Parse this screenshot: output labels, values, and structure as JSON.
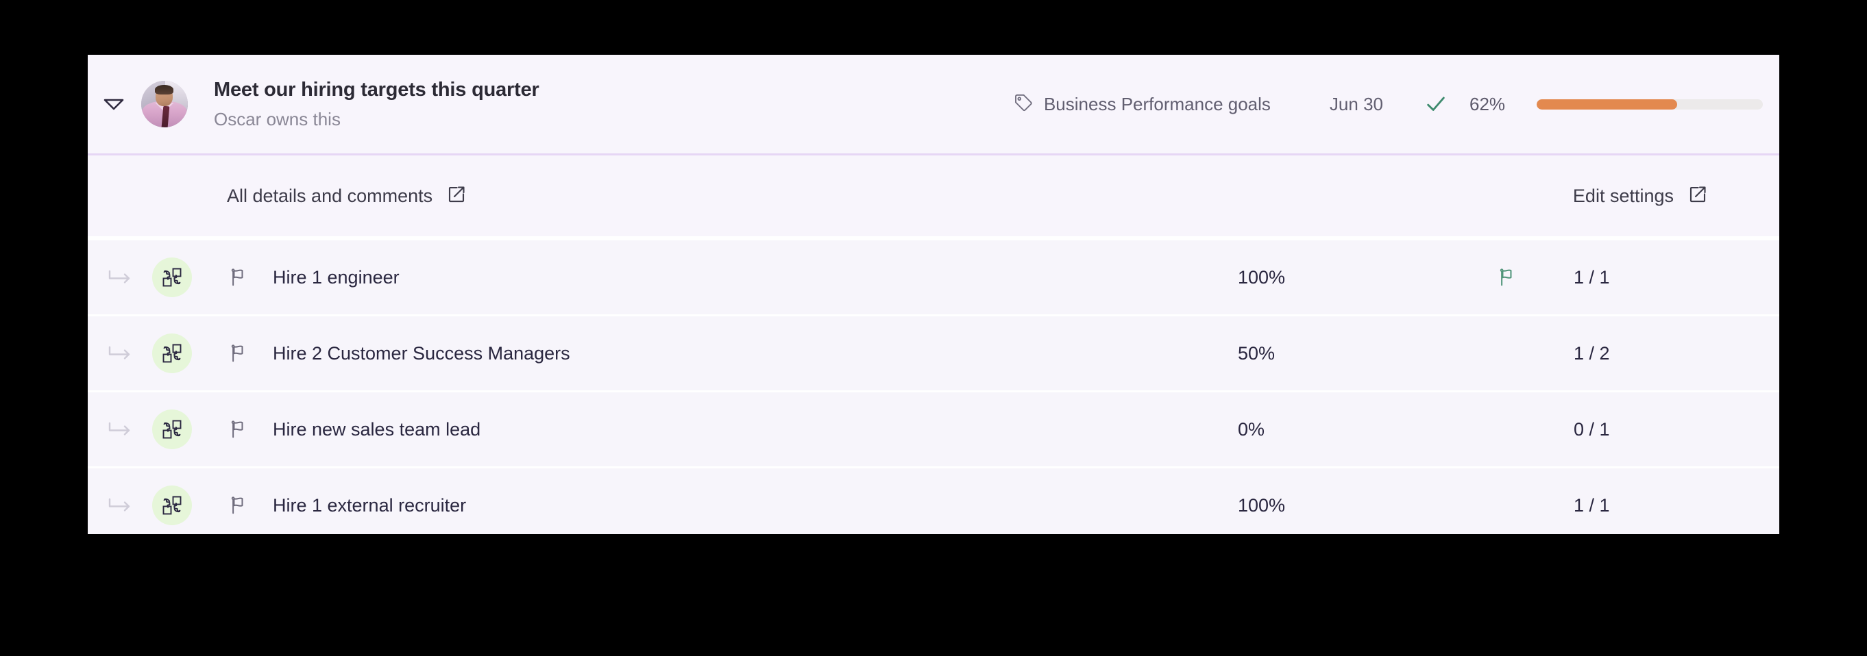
{
  "goal": {
    "collapse_icon": "chevron-down-icon",
    "avatar_icon": "owner-avatar",
    "title": "Meet our hiring targets this quarter",
    "owner": "Oscar owns this",
    "tag_icon": "tag-icon",
    "tag": "Business Performance goals",
    "due_date": "Jun 30",
    "status_icon": "check-icon",
    "progress_percent": "62%",
    "progress_value": 62,
    "colors": {
      "progress_fill": "#e3894f",
      "progress_track": "#eceaea",
      "check": "#3d8a6d",
      "card_bg": "#f8f5fc",
      "header_border": "#e6d6f5",
      "badge_bg": "#e6f6d9"
    }
  },
  "toolbar": {
    "details_label": "All details and comments",
    "details_icon": "external-link-icon",
    "settings_label": "Edit settings",
    "settings_icon": "external-link-icon"
  },
  "tasks": [
    {
      "subtask_icon": "subtask-arrow-icon",
      "badge_icon": "puzzle-pieces-icon",
      "flag_icon": "flag-outline-icon",
      "name": "Hire 1 engineer",
      "percent": "100%",
      "status_flag": "flag-green-icon",
      "count": "1 / 1"
    },
    {
      "subtask_icon": "subtask-arrow-icon",
      "badge_icon": "puzzle-pieces-icon",
      "flag_icon": "flag-outline-icon",
      "name": "Hire 2 Customer Success Managers",
      "percent": "50%",
      "status_flag": "",
      "count": "1 / 2"
    },
    {
      "subtask_icon": "subtask-arrow-icon",
      "badge_icon": "puzzle-pieces-icon",
      "flag_icon": "flag-outline-icon",
      "name": "Hire new sales team lead",
      "percent": "0%",
      "status_flag": "",
      "count": "0 / 1"
    },
    {
      "subtask_icon": "subtask-arrow-icon",
      "badge_icon": "puzzle-pieces-icon",
      "flag_icon": "flag-outline-icon",
      "name": "Hire 1 external recruiter",
      "percent": "100%",
      "status_flag": "",
      "count": "1 / 1"
    }
  ]
}
